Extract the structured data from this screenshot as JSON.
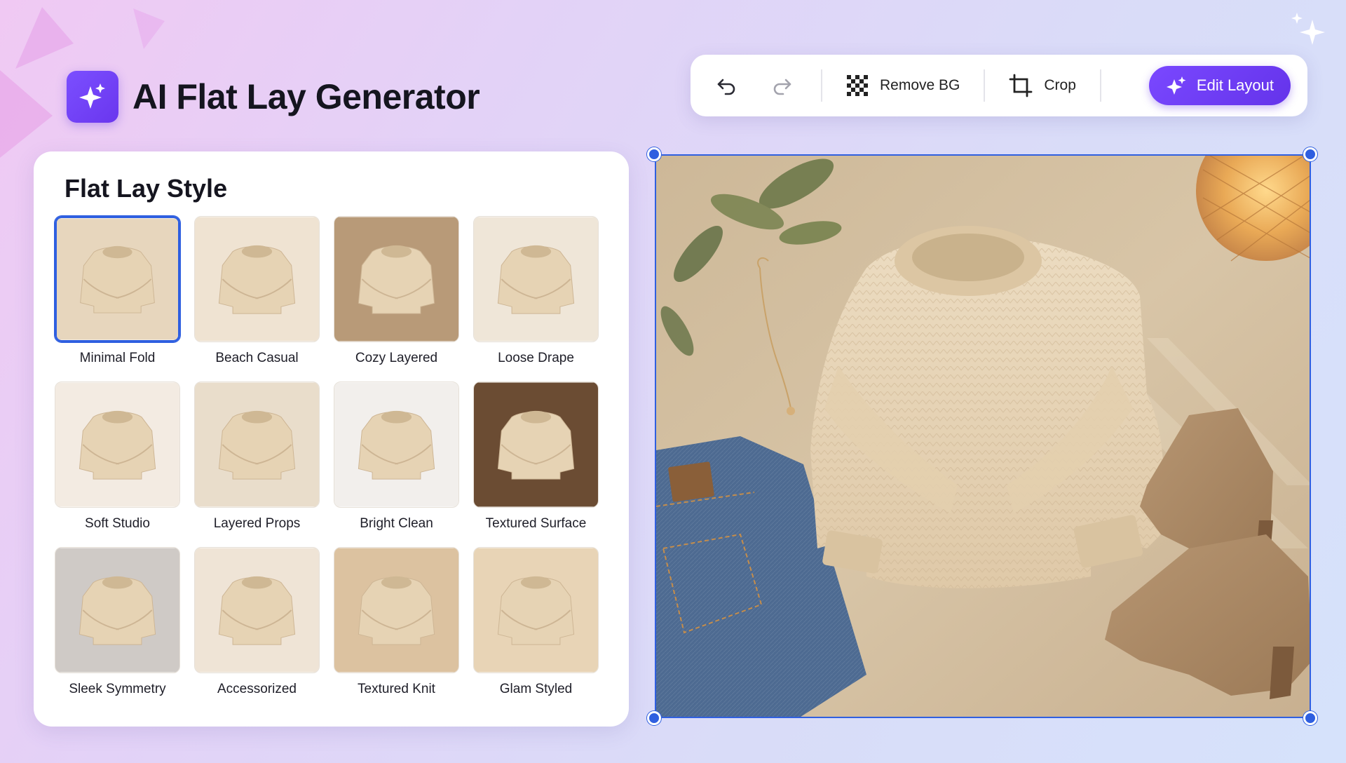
{
  "app": {
    "title": "AI Flat Lay Generator"
  },
  "toolbar": {
    "undo_icon": "undo-icon",
    "redo_icon": "redo-icon",
    "remove_bg_label": "Remove BG",
    "crop_label": "Crop",
    "edit_layout_label": "Edit Layout"
  },
  "style_panel": {
    "title": "Flat Lay Style",
    "selected": "Minimal Fold",
    "styles": [
      {
        "label": "Minimal Fold"
      },
      {
        "label": "Beach Casual"
      },
      {
        "label": "Cozy Layered"
      },
      {
        "label": "Loose Drape"
      },
      {
        "label": "Soft Studio"
      },
      {
        "label": "Layered Props"
      },
      {
        "label": "Bright Clean"
      },
      {
        "label": "Textured Surface"
      },
      {
        "label": "Sleek Symmetry"
      },
      {
        "label": "Accessorized"
      },
      {
        "label": "Textured Knit"
      },
      {
        "label": "Glam Styled"
      }
    ]
  },
  "colors": {
    "accent": "#6a36ee",
    "selection": "#2f5fe0",
    "sweater": "#e8d6b9",
    "linen": "#d9c6a8"
  }
}
